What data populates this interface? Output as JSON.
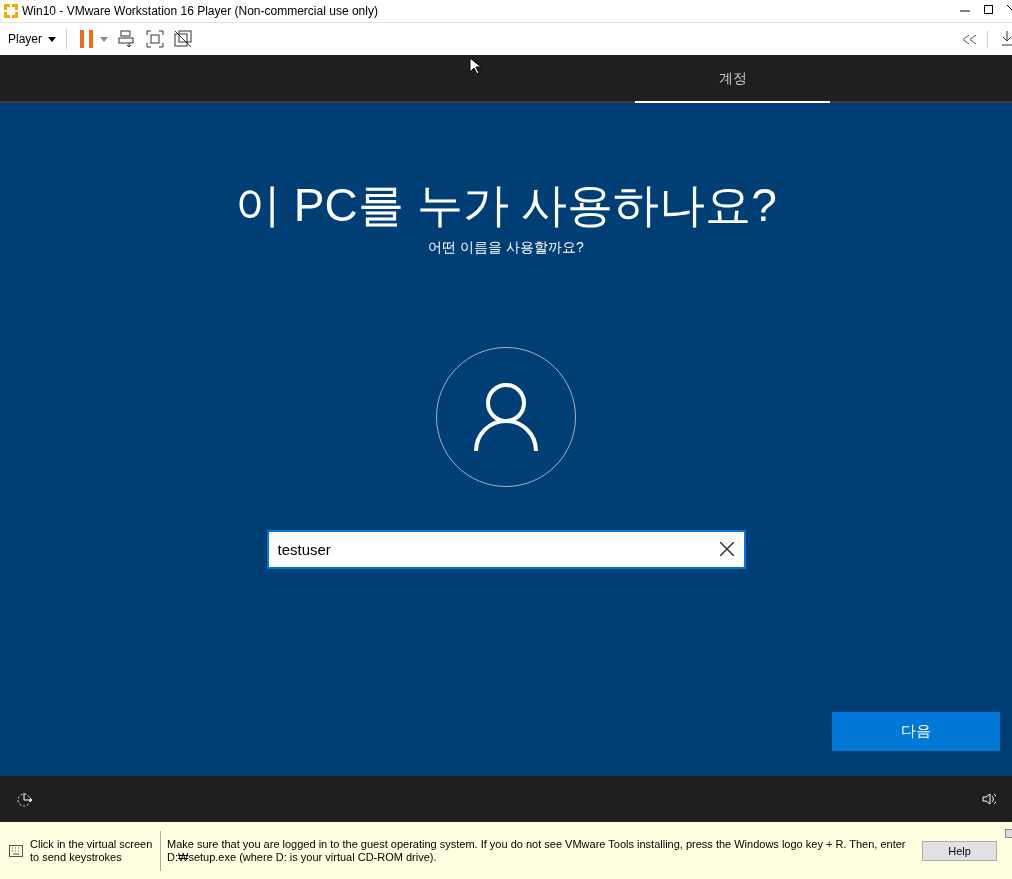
{
  "window": {
    "title": "Win10 - VMware Workstation 16 Player (Non-commercial use only)"
  },
  "toolbar": {
    "menu": "Player"
  },
  "oobe": {
    "tabs": [
      {
        "label": "계정",
        "selected": true
      }
    ],
    "heading": "이 PC를 누가 사용하나요?",
    "subheading": "어떤 이름을 사용할까요?",
    "name_field": {
      "value": "testuser"
    },
    "next_button": "다음"
  },
  "hint_bar": {
    "click_hint": "Click in the virtual screen to send keystrokes",
    "message": "Make sure that you are logged in to the guest operating system. If you do not see VMware Tools installing, press the Windows logo key + R. Then, enter D:₩setup.exe (where D: is your virtual CD-ROM drive).",
    "help_button": "Help"
  }
}
